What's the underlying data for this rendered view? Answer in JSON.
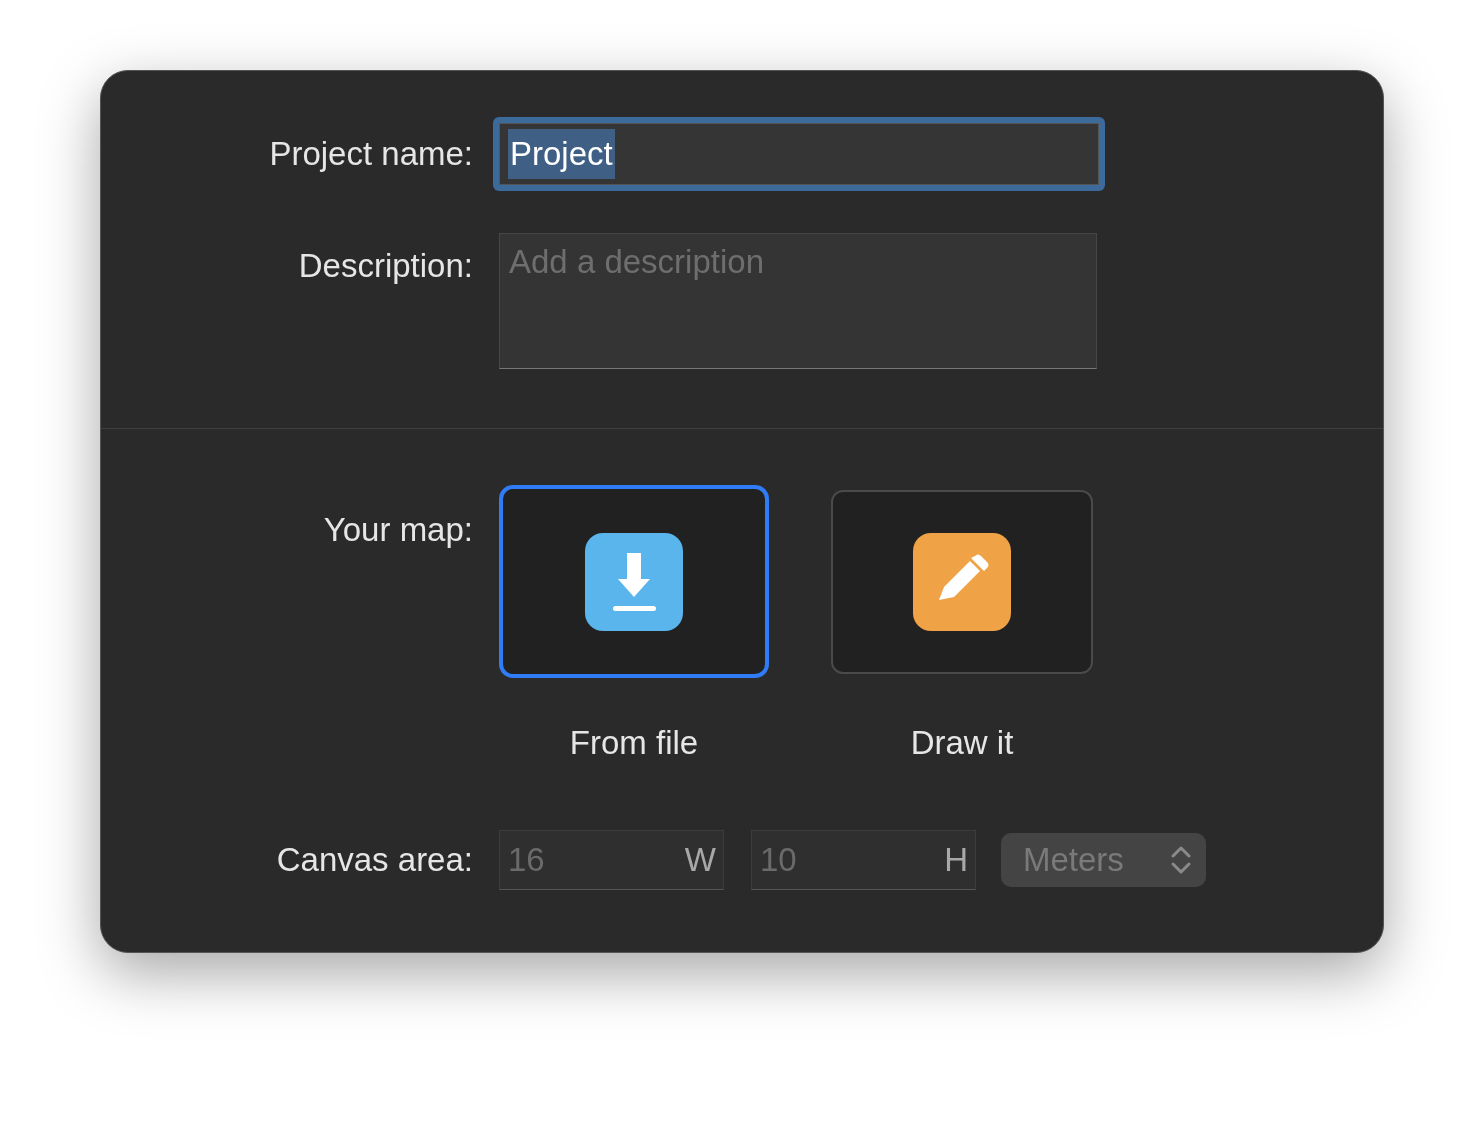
{
  "project_name": {
    "label": "Project name:",
    "value": "Project",
    "focused": true
  },
  "description": {
    "label": "Description:",
    "placeholder": "Add a description"
  },
  "map": {
    "label": "Your map:",
    "options": [
      {
        "kind": "file",
        "label": "From file",
        "selected": true
      },
      {
        "kind": "draw",
        "label": "Draw it",
        "selected": false
      }
    ]
  },
  "canvas_area": {
    "label": "Canvas area:",
    "disabled": true,
    "width": {
      "placeholder": "16",
      "unit": "W"
    },
    "height": {
      "placeholder": "10",
      "unit": "H"
    },
    "units": {
      "value": "Meters"
    }
  }
}
